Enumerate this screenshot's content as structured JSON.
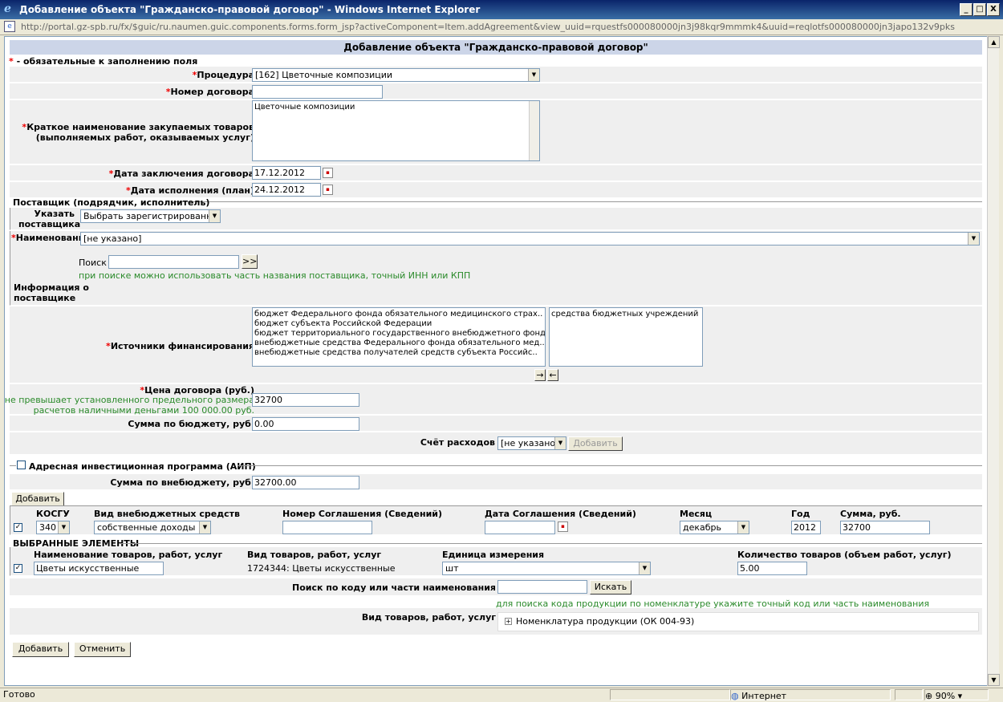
{
  "window": {
    "title": "Добавление объекта \"Гражданско-правовой договор\" - Windows Internet Explorer",
    "url": "http://portal.gz-spb.ru/fx/$guic/ru.naumen.guic.components.forms.form_jsp?activeComponent=Item.addAgreement&view_uuid=rquestfs000080000jn3j98kqr9mmmk4&uuid=reqlotfs000080000jn3japo132v9pks",
    "min": "_",
    "max": "□",
    "close": "X"
  },
  "page": {
    "title": "Добавление объекта \"Гражданско-правовой договор\"",
    "required_note": " - обязательные к заполнению поля",
    "asterisk": "*"
  },
  "form": {
    "procedure_label": "Процедура",
    "procedure_value": "[162] Цветочные композиции",
    "contract_number_label": "Номер договора",
    "contract_number_value": "",
    "short_name_label_1": "Краткое наименование закупаемых товаров",
    "short_name_label_2": "(выполняемых работ, оказываемых услуг)",
    "short_name_value": "Цветочные композиции",
    "date_concluded_label": "Дата заключения договора",
    "date_concluded_value": "17.12.2012",
    "date_exec_label": "Дата исполнения (план)",
    "date_exec_value": "24.12.2012"
  },
  "supplier": {
    "legend": "Поставщик (подрядчик, исполнитель)",
    "specify_label_1": "Указать",
    "specify_label_2": "поставщика",
    "specify_value": "Выбрать зарегистрированного",
    "name_label": "Наименование",
    "name_value": "[не указано]",
    "search_label": "Поиск",
    "search_value": "",
    "search_button": ">>",
    "search_hint": "при поиске можно использовать часть названия поставщика, точный ИНН или КПП",
    "info_label_1": "Информация о",
    "info_label_2": "поставщике"
  },
  "finance": {
    "label": "Источники финансирования",
    "available": [
      "бюджет Федерального фонда обязательного медицинского страх..",
      "бюджет субъекта Российской Федерации",
      "бюджет территориального государственного внебюджетного фонда",
      "внебюджетные средства Федерального фонда обязательного мед..",
      "внебюджетные средства получателей средств субъекта Российс.."
    ],
    "selected": [
      "средства бюджетных учреждений"
    ],
    "btn_add": "→",
    "btn_remove": "←",
    "price_label": "Цена договора (руб.)",
    "price_note_1": "не превышает установленного предельного размера",
    "price_note_2": "расчетов наличными деньгами 100 000.00 руб.",
    "price_value": "32700",
    "budget_sum_label": "Сумма по бюджету, руб.",
    "budget_sum_value": "0.00",
    "account_label": "Счёт расходов",
    "account_value": "[не указано]",
    "account_add": "Добавить",
    "aip_label": "Адресная инвестиционная программа (АИП)",
    "extra_sum_label": "Сумма по внебюджету, руб.",
    "extra_sum_value": "32700.00",
    "add_button": "Добавить"
  },
  "grid": {
    "headers": [
      "КОСГУ",
      "Вид внебюджетных средств",
      "Номер Соглашения (Сведений)",
      "Дата Соглашения (Сведений)",
      "Месяц",
      "Год",
      "Сумма, руб."
    ],
    "row": {
      "checked": "✓",
      "kosgu": "340",
      "kind": "собственные доходы",
      "agreement_no": "",
      "agreement_date": "",
      "month": "декабрь",
      "year": "2012",
      "sum": "32700"
    }
  },
  "selected_items": {
    "legend": "ВЫБРАННЫЕ ЭЛЕМЕНТЫ",
    "headers": [
      "Наименование товаров, работ, услуг",
      "Вид товаров, работ, услуг",
      "Единица измерения",
      "Количество товаров (объем работ, услуг)"
    ],
    "row": {
      "checked": "✓",
      "name": "Цветы искусственные",
      "kind": "1724344: Цветы искусственные",
      "unit": "шт",
      "qty": "5.00"
    }
  },
  "code_search": {
    "label": "Поиск по коду или части наименования",
    "value": "",
    "button": "Искать",
    "hint": "для поиска кода продукции по номенклатуре укажите точный код или часть наименования",
    "kind_label": "Вид товаров, работ, услуг",
    "tree_item": "Номенклатура продукции (ОК 004-93)",
    "tree_toggle": "+"
  },
  "actions": {
    "add": "Добавить",
    "cancel": "Отменить"
  },
  "statusbar": {
    "left": "Готово",
    "zone": "Интернет",
    "zoom": "90%"
  }
}
